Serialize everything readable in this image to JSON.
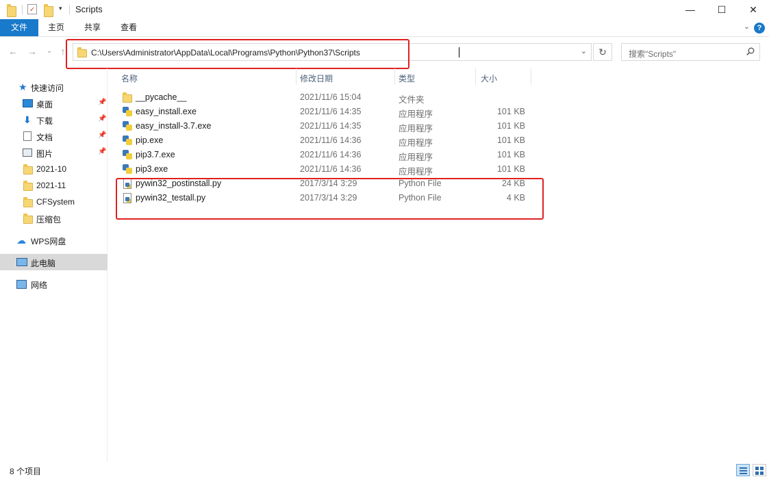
{
  "window": {
    "title": "Scripts",
    "minimize": "—",
    "maximize": "☐",
    "close": "✕"
  },
  "ribbon": {
    "tabs": [
      {
        "label": "文件"
      },
      {
        "label": "主页"
      },
      {
        "label": "共享"
      },
      {
        "label": "查看"
      }
    ],
    "expand_glyph": "⌄",
    "help_glyph": "?"
  },
  "address": {
    "path": "C:\\Users\\Administrator\\AppData\\Local\\Programs\\Python\\Python37\\Scripts",
    "dropdown_glyph": "⌄",
    "refresh_glyph": "↻"
  },
  "nav_buttons": {
    "back": "←",
    "forward": "→",
    "recent": "⌄",
    "up": "↑"
  },
  "search": {
    "placeholder": "搜索\"Scripts\""
  },
  "navpane": {
    "items": [
      {
        "label": "快速访问",
        "icon": "star-icon"
      },
      {
        "label": "桌面",
        "icon": "desktop-icon",
        "pinned": true
      },
      {
        "label": "下载",
        "icon": "download-icon",
        "pinned": true
      },
      {
        "label": "文档",
        "icon": "document-icon",
        "pinned": true
      },
      {
        "label": "图片",
        "icon": "picture-icon",
        "pinned": true
      },
      {
        "label": "2021-10",
        "icon": "folder-icon"
      },
      {
        "label": "2021-11",
        "icon": "folder-icon"
      },
      {
        "label": "CFSystem",
        "icon": "folder-icon"
      },
      {
        "label": "压缩包",
        "icon": "folder-icon"
      },
      {
        "label": "WPS网盘",
        "icon": "cloud-icon"
      },
      {
        "label": "此电脑",
        "icon": "pc-icon",
        "selected": true
      },
      {
        "label": "网络",
        "icon": "network-icon"
      }
    ]
  },
  "columns": {
    "name": "名称",
    "date": "修改日期",
    "type": "类型",
    "size": "大小"
  },
  "files": [
    {
      "name": "__pycache__",
      "date": "2021/11/6 15:04",
      "type": "文件夹",
      "size": "",
      "icon": "folder-icon"
    },
    {
      "name": "easy_install.exe",
      "date": "2021/11/6 14:35",
      "type": "应用程序",
      "size": "101 KB",
      "icon": "python-exe-icon"
    },
    {
      "name": "easy_install-3.7.exe",
      "date": "2021/11/6 14:35",
      "type": "应用程序",
      "size": "101 KB",
      "icon": "python-exe-icon"
    },
    {
      "name": "pip.exe",
      "date": "2021/11/6 14:36",
      "type": "应用程序",
      "size": "101 KB",
      "icon": "python-exe-icon"
    },
    {
      "name": "pip3.7.exe",
      "date": "2021/11/6 14:36",
      "type": "应用程序",
      "size": "101 KB",
      "icon": "python-exe-icon"
    },
    {
      "name": "pip3.exe",
      "date": "2021/11/6 14:36",
      "type": "应用程序",
      "size": "101 KB",
      "icon": "python-exe-icon"
    },
    {
      "name": "pywin32_postinstall.py",
      "date": "2017/3/14 3:29",
      "type": "Python File",
      "size": "24 KB",
      "icon": "python-file-icon"
    },
    {
      "name": "pywin32_testall.py",
      "date": "2017/3/14 3:29",
      "type": "Python File",
      "size": "4 KB",
      "icon": "python-file-icon"
    }
  ],
  "status": {
    "item_count": "8 个项目"
  },
  "colors": {
    "accent": "#1979ca",
    "highlight_box": "#e02020",
    "selected_nav": "#d9d9d9"
  }
}
